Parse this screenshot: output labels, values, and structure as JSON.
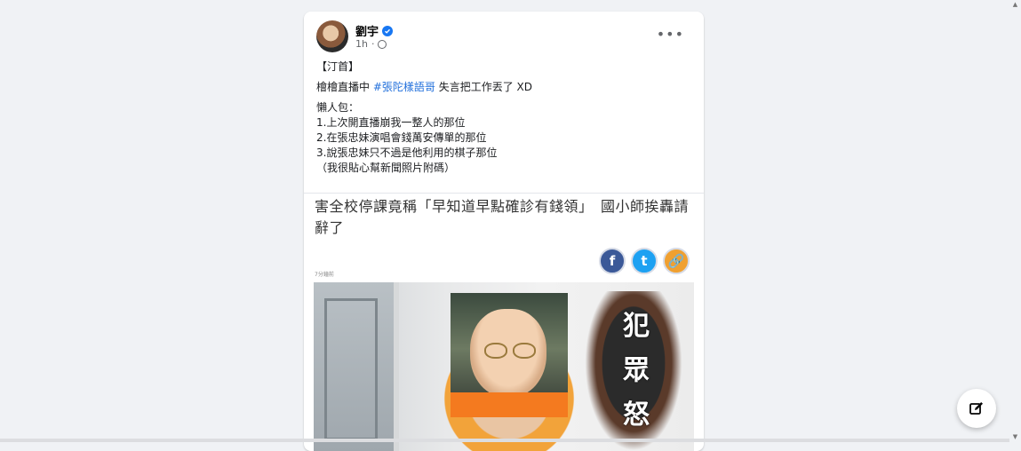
{
  "post": {
    "author": "劉宇",
    "time": "1h",
    "more_label": "•••",
    "text": {
      "line1": "【汀首】",
      "line2_prefix": "檜檜直播中",
      "hashtag": "#張陀樣語哥",
      "line2_suffix": "失言把工作丟了 XD",
      "line3": "懶人包：",
      "item1": "1.上次開直播崩我一整人的那位",
      "item2": "2.在張忠妹演唱會錢萬安傳單的那位",
      "item3": "3.說張忠妹只不過是他利用的棋子那位",
      "note": "（我很貼心幫新聞照片附碼）"
    },
    "link_preview": {
      "headline": "害全校停課竟稱「早知道早點確診有錢領」　國小師挨轟請辭了",
      "caption": "7分鐘前",
      "share_facebook": "f",
      "share_twitter": "t",
      "share_link": "🔗",
      "image_text": [
        "犯",
        "眾",
        "怒"
      ]
    }
  },
  "colors": {
    "background": "#f0f2f5",
    "card": "#ffffff",
    "hashtag": "#216fdb",
    "verified": "#1877f2",
    "facebook": "#3b5998",
    "twitter": "#1da1f2",
    "link": "#f0a030"
  },
  "icons": {
    "verified": "verified-badge-icon",
    "globe": "globe-icon",
    "more": "more-horizontal-icon",
    "compose": "new-message-icon"
  }
}
